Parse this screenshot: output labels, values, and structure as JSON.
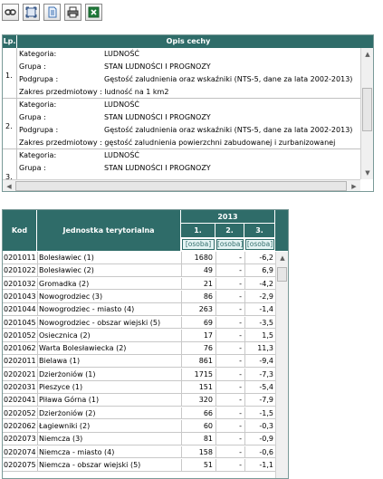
{
  "toolbar": {
    "buttons": [
      "link-icon",
      "fit-icon",
      "document-icon",
      "print-icon",
      "excel-export-icon"
    ]
  },
  "features_panel": {
    "header": {
      "lp": "Lp.",
      "opis": "Opis cechy"
    },
    "records": [
      {
        "num": "1.",
        "kategoria_label": "Kategoria:",
        "kategoria": "LUDNOŚĆ",
        "grupa_label": "Grupa :",
        "grupa": "STAN LUDNOŚCI I PROGNOZY",
        "podgrupa_label": "Podgrupa :",
        "podgrupa": "Gęstość zaludnienia oraz wskaźniki (NTS-5, dane za lata 2002-2013)",
        "zakres": "Zakres przedmiotowy : ludność na 1 km2"
      },
      {
        "num": "2.",
        "kategoria_label": "Kategoria:",
        "kategoria": "LUDNOŚĆ",
        "grupa_label": "Grupa :",
        "grupa": "STAN LUDNOŚCI I PROGNOZY",
        "podgrupa_label": "Podgrupa :",
        "podgrupa": "Gęstość zaludnienia oraz wskaźniki (NTS-5, dane za lata 2002-2013)",
        "zakres": "Zakres przedmiotowy : gęstość zaludnienia powierzchni zabudowanej i zurbanizowanej"
      },
      {
        "num": "3.",
        "kategoria_label": "Kategoria:",
        "kategoria": "LUDNOŚĆ",
        "grupa_label": "Grupa :",
        "grupa": "STAN LUDNOŚCI I PROGNOZY"
      }
    ]
  },
  "data_table": {
    "headers": {
      "kod": "Kod",
      "jednostka": "Jednostka terytorialna",
      "year": "2013",
      "col1": "1.",
      "col2": "2.",
      "col3": "3."
    },
    "units": {
      "col1": "[osoba]",
      "col2": "[osoba]",
      "col3": "[osoba]"
    },
    "rows": [
      {
        "kod": "0201011",
        "name": "Bolesławiec (1)",
        "v1": "1680",
        "v2": "-",
        "v3": "-6,2"
      },
      {
        "kod": "0201022",
        "name": "Bolesławiec (2)",
        "v1": "49",
        "v2": "-",
        "v3": "6,9"
      },
      {
        "kod": "0201032",
        "name": "Gromadka (2)",
        "v1": "21",
        "v2": "-",
        "v3": "-4,2"
      },
      {
        "kod": "0201043",
        "name": "Nowogrodziec (3)",
        "v1": "86",
        "v2": "-",
        "v3": "-2,9"
      },
      {
        "kod": "0201044",
        "name": "Nowogrodziec - miasto (4)",
        "v1": "263",
        "v2": "-",
        "v3": "-1,4"
      },
      {
        "kod": "0201045",
        "name": "Nowogrodziec - obszar wiejski (5)",
        "v1": "69",
        "v2": "-",
        "v3": "-3,5"
      },
      {
        "kod": "0201052",
        "name": "Osiecznica (2)",
        "v1": "17",
        "v2": "-",
        "v3": "1,5"
      },
      {
        "kod": "0201062",
        "name": "Warta Bolesławiecka (2)",
        "v1": "76",
        "v2": "-",
        "v3": "11,3"
      },
      {
        "kod": "0202011",
        "name": "Bielawa (1)",
        "v1": "861",
        "v2": "-",
        "v3": "-9,4"
      },
      {
        "kod": "0202021",
        "name": "Dzierżoniów (1)",
        "v1": "1715",
        "v2": "-",
        "v3": "-7,3"
      },
      {
        "kod": "0202031",
        "name": "Pieszyce (1)",
        "v1": "151",
        "v2": "-",
        "v3": "-5,4"
      },
      {
        "kod": "0202041",
        "name": "Piława Górna (1)",
        "v1": "320",
        "v2": "-",
        "v3": "-7,9"
      },
      {
        "kod": "0202052",
        "name": "Dzierżoniów (2)",
        "v1": "66",
        "v2": "-",
        "v3": "-1,5"
      },
      {
        "kod": "0202062",
        "name": "Łagiewniki (2)",
        "v1": "60",
        "v2": "-",
        "v3": "-0,3"
      },
      {
        "kod": "0202073",
        "name": "Niemcza (3)",
        "v1": "81",
        "v2": "-",
        "v3": "-0,9"
      },
      {
        "kod": "0202074",
        "name": "Niemcza - miasto (4)",
        "v1": "158",
        "v2": "-",
        "v3": "-0,6"
      },
      {
        "kod": "0202075",
        "name": "Niemcza - obszar wiejski (5)",
        "v1": "51",
        "v2": "-",
        "v3": "-1,1"
      }
    ]
  }
}
